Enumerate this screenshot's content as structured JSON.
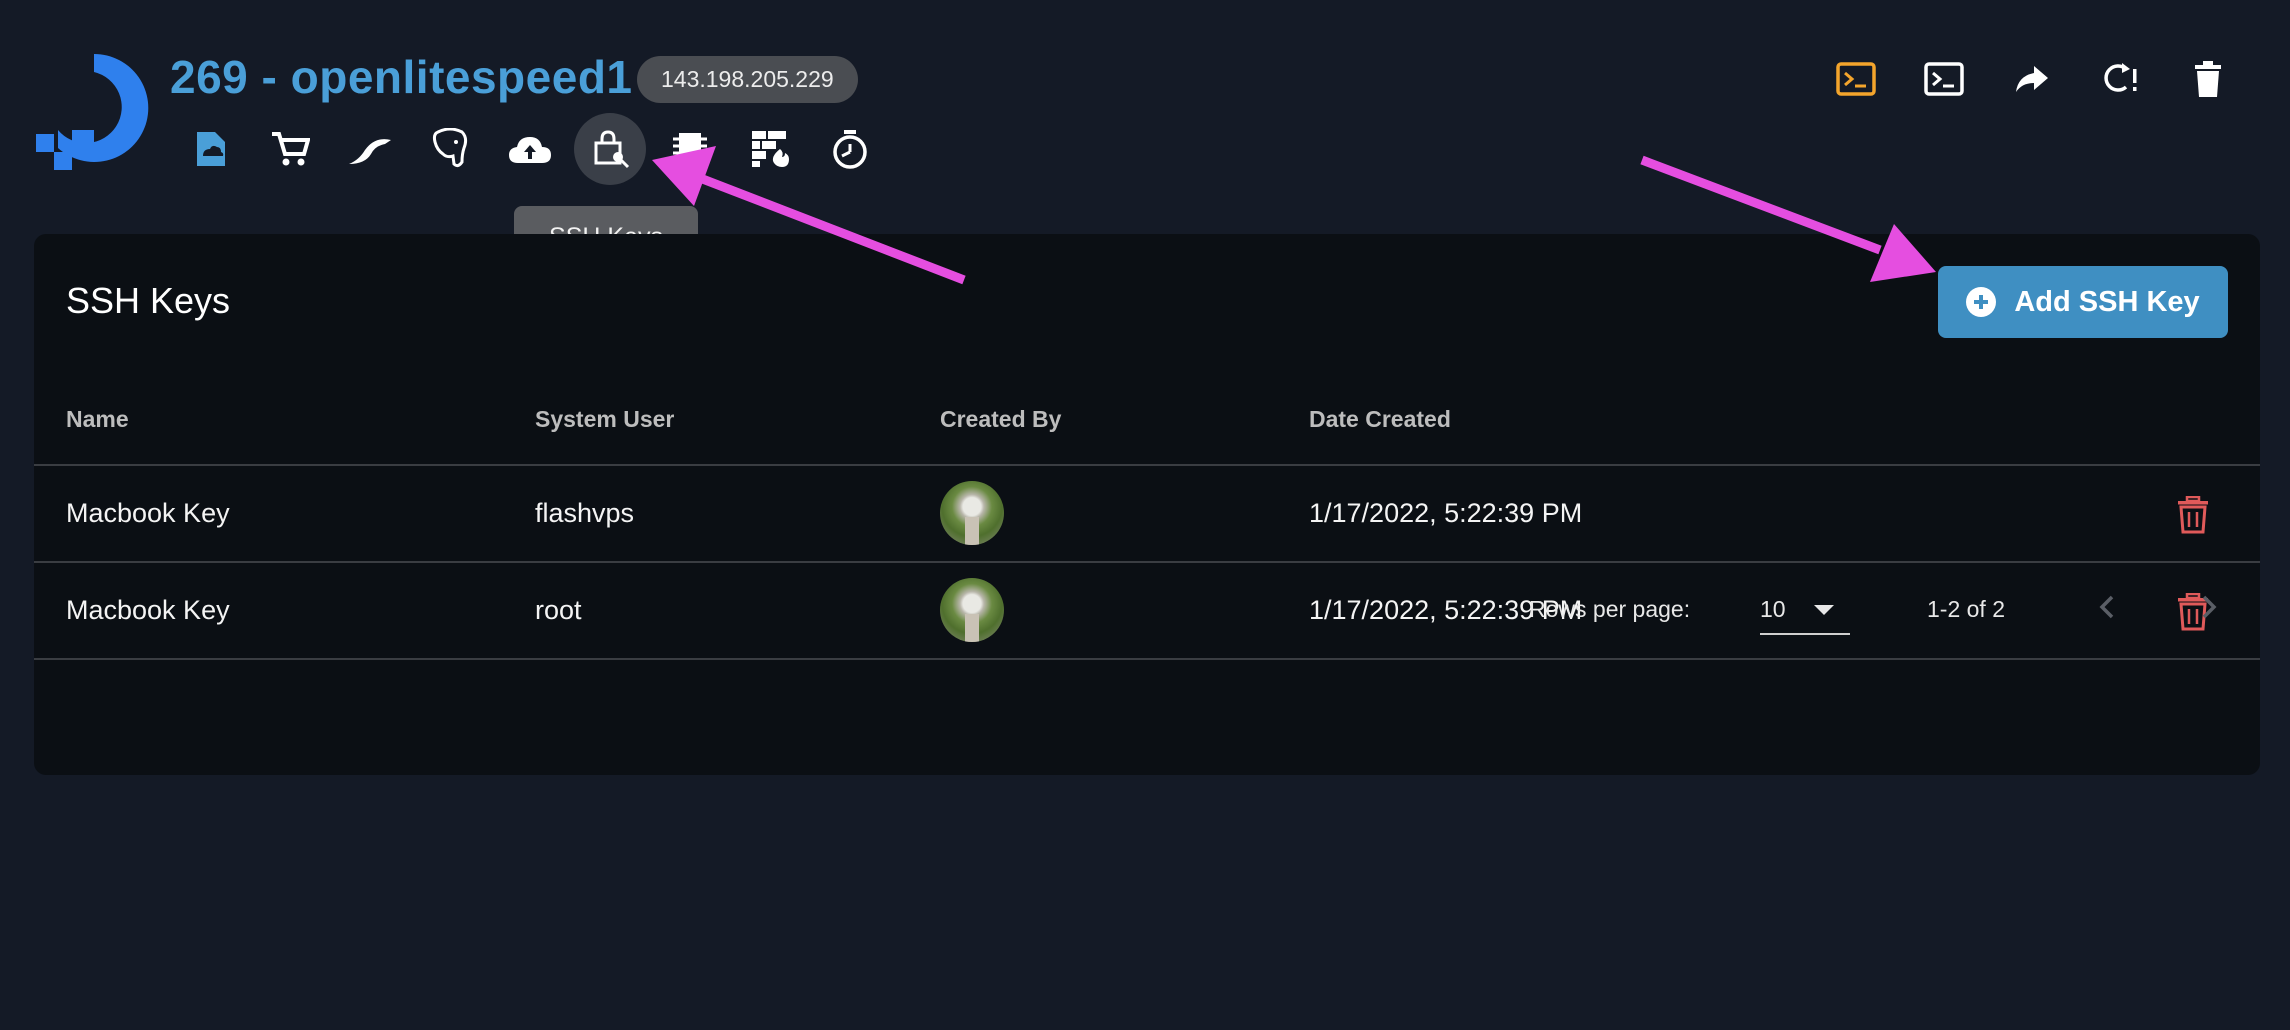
{
  "header": {
    "title": "269 - openlitespeed1",
    "ip": "143.198.205.229",
    "logo_icon": "digitalocean-logo",
    "tools": [
      {
        "name": "cloud-storage-icon",
        "color": "#4a9fd8"
      },
      {
        "name": "cart-icon",
        "color": "#ffffff"
      },
      {
        "name": "mysql-icon",
        "color": "#ffffff"
      },
      {
        "name": "postgres-icon",
        "color": "#ffffff"
      },
      {
        "name": "cloud-upload-icon",
        "color": "#ffffff"
      },
      {
        "name": "ssh-keys-icon",
        "color": "#ffffff",
        "active": true
      },
      {
        "name": "memory-icon",
        "color": "#ffffff"
      },
      {
        "name": "firewall-icon",
        "color": "#ffffff"
      },
      {
        "name": "backup-timer-icon",
        "color": "#ffffff"
      }
    ],
    "tooltip": "SSH Keys",
    "actions": [
      "terminal-orange-icon",
      "terminal-icon",
      "share-icon",
      "restart-icon",
      "delete-icon"
    ]
  },
  "card": {
    "title": "SSH Keys",
    "add_button": "Add SSH Key",
    "columns": {
      "name": "Name",
      "system_user": "System User",
      "created_by": "Created By",
      "date_created": "Date Created"
    },
    "rows": [
      {
        "name": "Macbook Key",
        "system_user": "flashvps",
        "date_created": "1/17/2022, 5:22:39 PM"
      },
      {
        "name": "Macbook Key",
        "system_user": "root",
        "date_created": "1/17/2022, 5:22:39 PM"
      }
    ],
    "pagination": {
      "rows_per_page_label": "Rows per page:",
      "rows_per_page": "10",
      "range": "1-2 of 2"
    }
  },
  "colors": {
    "background": "#141a26",
    "card": "#0b0f14",
    "accent": "#4a9fd8",
    "button": "#3f8fc2",
    "danger": "#e05a5a",
    "annotation": "#e54ee0"
  }
}
